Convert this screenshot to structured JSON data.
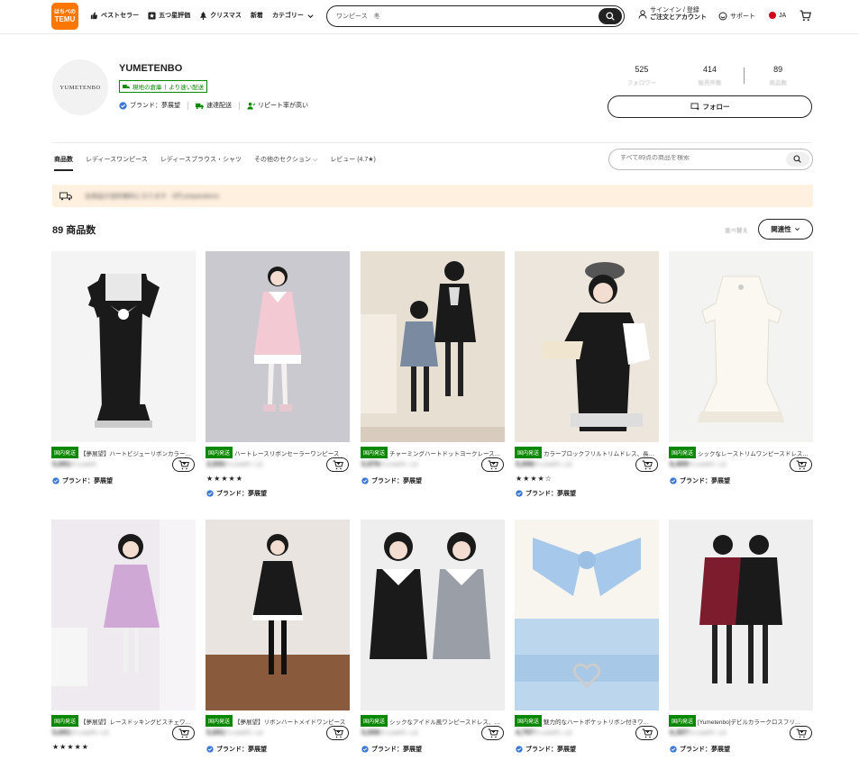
{
  "header": {
    "logo_top": "はちべの",
    "logo_bottom": "TEMU",
    "nav": [
      {
        "label": "ベストセラー",
        "icon": "thumbs-up-icon"
      },
      {
        "label": "五つ星評価",
        "icon": "star-box-icon"
      },
      {
        "label": "クリスマス",
        "icon": "tree-icon"
      },
      {
        "label": "新着",
        "icon": ""
      },
      {
        "label": "カテゴリー",
        "icon": "chevron-down-icon"
      }
    ],
    "search_value": "ワンピース　冬",
    "signin_line1": "サインイン / 登録",
    "signin_line2": "ご注文とアカウント",
    "support": "サポート",
    "lang": "JA"
  },
  "store": {
    "avatar_text": "YUMETENBO",
    "name": "YUMETENBO",
    "warehouse_tag": "現地の倉庫",
    "warehouse_tag2": "より速い配送",
    "features": [
      "ブランド：夢展望",
      "速達配送",
      "リピート率が高い"
    ],
    "stats": [
      {
        "num": "525",
        "label": "フォロワー"
      },
      {
        "num": "414",
        "label": "販売件数"
      },
      {
        "num": "89",
        "label": "商品数"
      }
    ],
    "follow": "フォロー"
  },
  "tabs": [
    {
      "label": "商品数",
      "active": true
    },
    {
      "label": "レディースワンピース",
      "active": false
    },
    {
      "label": "レディースブラウス・シャツ",
      "active": false
    },
    {
      "label": "その他のセクション",
      "active": false
    },
    {
      "label": "レビュー (4.7★)",
      "active": false
    }
  ],
  "store_search_placeholder": "すべて89点の商品を検索",
  "banner_msg": "全商品が送料無料になります · 0円 preparations",
  "product_count": "89 商品数",
  "sort_label": "並べ替え",
  "sort_value": "関連性",
  "products": [
    {
      "badge": "国内発送",
      "title": "【夢展望】ハートビジューリボンカラークワ…",
      "price": "5,691",
      "sub": "円 4,949円",
      "stars": "",
      "brand": "ブランド：夢展望"
    },
    {
      "badge": "国内発送",
      "title": "ハートレースリボンセーラーワンピース",
      "price": "3,555",
      "sub": "円 4,949円 / 1点",
      "stars": "★★★★★",
      "brand": "ブランド：夢展望"
    },
    {
      "badge": "国内発送",
      "title": "チャーミングハートドットヨークレースアップ…",
      "price": "5,976",
      "sub": "円 4,949円 / 1点",
      "stars": "",
      "brand": "ブランド：夢展望"
    },
    {
      "badge": "国内発送",
      "title": "カラーブロックフリルトリムドレス、長…",
      "price": "5,006",
      "sub": "円 4,949円 / 1点",
      "stars": "★★★★☆",
      "brand": "ブランド：夢展望"
    },
    {
      "badge": "国内発送",
      "title": "シックなレーストリムワンピースドレス、…",
      "price": "6,409",
      "sub": "円 4,949円 / 1点",
      "stars": "",
      "brand": "ブランド：夢展望"
    },
    {
      "badge": "国内発送",
      "title": "【夢展望】レースドッキングビスチェワ…",
      "price": "5,691",
      "sub": "円 4,949円 / 1点",
      "stars": "★★★★★",
      "brand": ""
    },
    {
      "badge": "国内発送",
      "title": "【夢展望】リボンハートメイドワンピース",
      "price": "5,691",
      "sub": "円 4,949円 / 1点",
      "stars": "",
      "brand": "ブランド：夢展望"
    },
    {
      "badge": "国内発送",
      "title": "シックなアイドル風ワンピースドレス、…",
      "price": "5,006",
      "sub": "円 4,949円 / 1点",
      "stars": "",
      "brand": "ブランド：夢展望"
    },
    {
      "badge": "国内発送",
      "title": "魅力的なハートポケットリボン付きワ…",
      "price": "4,797",
      "sub": "円 4,949円 / 1点",
      "stars": "",
      "brand": "ブランド：夢展望"
    },
    {
      "badge": "国内発送",
      "title": "[Yumetenbo]デビルカラークロスフリ…",
      "price": "6,307",
      "sub": "円 4,949円 / 1点",
      "stars": "",
      "brand": "ブランド：夢展望"
    }
  ],
  "colors": {
    "accent": "#fb7701",
    "badge_green": "#0a8800",
    "banner_bg": "#fff0e0"
  }
}
